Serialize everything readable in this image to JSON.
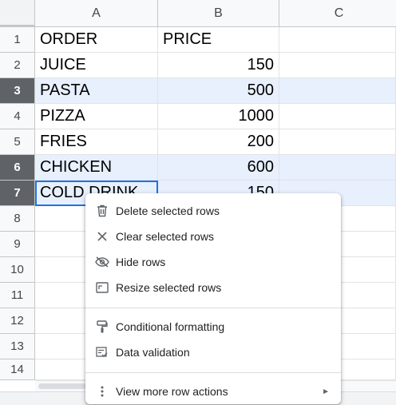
{
  "columns": [
    "A",
    "B",
    "C"
  ],
  "rows": [
    "1",
    "2",
    "3",
    "4",
    "5",
    "6",
    "7",
    "8",
    "9",
    "10",
    "11",
    "12",
    "13",
    "14"
  ],
  "cells": {
    "a1": "ORDER",
    "b1": "PRICE",
    "a2": "JUICE",
    "b2": "150",
    "a3": "PASTA",
    "b3": "500",
    "a4": "PIZZA",
    "b4": "1000",
    "a5": "FRIES",
    "b5": "200",
    "a6": "CHICKEN",
    "b6": "600",
    "a7": "COLD DRINK",
    "b7": "150"
  },
  "selected_rows": [
    "3",
    "6",
    "7"
  ],
  "context_menu": {
    "delete_rows": "Delete selected rows",
    "clear_rows": "Clear selected rows",
    "hide_rows": "Hide rows",
    "resize_rows": "Resize selected rows",
    "conditional_formatting": "Conditional formatting",
    "data_validation": "Data validation",
    "more_row_actions": "View more row actions"
  },
  "icons": {
    "delete": "trash-icon",
    "clear": "close-icon",
    "hide": "eye-off-icon",
    "resize": "resize-icon",
    "conditional": "paint-roller-icon",
    "validation": "checklist-icon",
    "more": "more-vertical-icon",
    "submenu": "chevron-right-icon"
  },
  "colors": {
    "selection_fill": "#e8f0fe",
    "selection_border": "#1a73e8",
    "selected_header": "#5f6368"
  }
}
